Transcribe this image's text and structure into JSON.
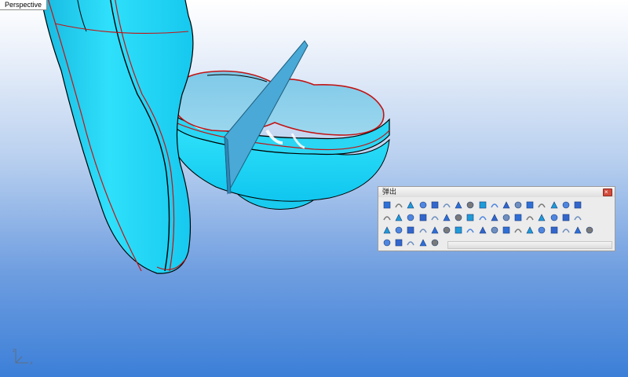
{
  "viewport": {
    "label": "Perspective"
  },
  "toolbar": {
    "title": "弹出",
    "rows": [
      [
        "lightbulb-icon",
        "lock-icon",
        "save-icon",
        "zoom-extents-icon",
        "zoom-window-icon",
        "render-sphere-icon",
        "color-wheel-icon",
        "layers-icon",
        "spotlight-icon",
        "rotate-icon",
        "plane-icon",
        "cube-icon",
        "arc-icon",
        "dimension-icon",
        "points-icon",
        "revolve-icon",
        "sweep-icon"
      ],
      [
        "tree-icon",
        "grid-icon",
        "fill-icon",
        "surface-icon",
        "curve-icon",
        "network-icon",
        "box-icon",
        "cylinder-icon",
        "panel-icon",
        "surface-plane-icon",
        "patch-icon",
        "sphere-icon",
        "torus-icon",
        "ellipsoid-icon",
        "cone-icon",
        "pipe-icon",
        "arch-icon"
      ],
      [
        "solid-box-icon",
        "bend-icon",
        "blend-icon",
        "wave-icon",
        "figure-icon",
        "sine-icon",
        "column-icon",
        "bracket-icon",
        "array-icon",
        "solid-cylinder-icon",
        "cup-icon",
        "ring-icon",
        "tube-icon",
        "slab-icon",
        "shield-icon",
        "mushroom-icon",
        "disk-icon",
        "flat-surface-icon"
      ],
      [
        "blue-panel-icon",
        "twisted-panel-icon",
        "mirror-icon",
        "swap-icon",
        "extrude-icon"
      ]
    ]
  },
  "colors": {
    "model-fill": "#1fd2f0",
    "edge": "#c21414",
    "plane": "#4aa9d6",
    "bg-bottom": "#3c7fd8"
  }
}
